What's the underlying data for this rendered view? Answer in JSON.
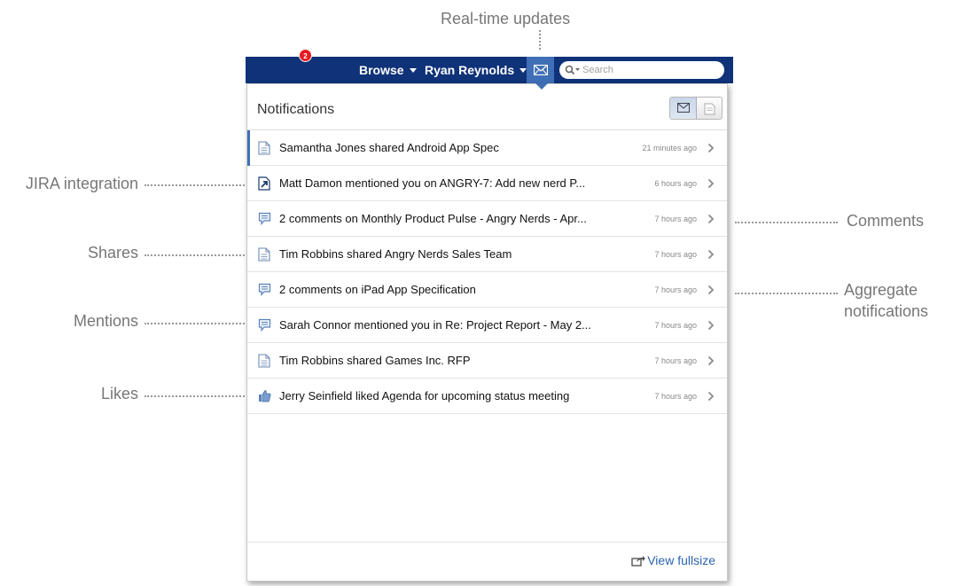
{
  "annotations": {
    "realtime": "Real-time updates",
    "jira": "JIRA integration",
    "shares": "Shares",
    "mentions": "Mentions",
    "likes": "Likes",
    "comments": "Comments",
    "aggregate_line1": "Aggregate",
    "aggregate_line2": "notifications"
  },
  "topbar": {
    "browse_label": "Browse",
    "user_label": "Ryan Reynolds",
    "badge_count": "2",
    "search_placeholder": "Search",
    "bar_color": "#0f3278",
    "mail_active_color": "#3f6fb6"
  },
  "panel": {
    "title": "Notifications",
    "view_fullsize": "View fullsize"
  },
  "notifications": [
    {
      "icon": "document-icon",
      "text": "Samantha Jones shared Android App Spec",
      "time": "21 minutes ago",
      "unread": true
    },
    {
      "icon": "jira-icon",
      "text": "Matt Damon mentioned you on ANGRY-7: Add new nerd P...",
      "time": "6 hours ago",
      "unread": false
    },
    {
      "icon": "comment-icon",
      "text": "2 comments on Monthly Product Pulse - Angry Nerds - Apr...",
      "time": "7 hours ago",
      "unread": false
    },
    {
      "icon": "document-icon",
      "text": "Tim Robbins shared Angry Nerds Sales Team",
      "time": "7 hours ago",
      "unread": false
    },
    {
      "icon": "comment-icon",
      "text": "2 comments on iPad App Specification",
      "time": "7 hours ago",
      "unread": false
    },
    {
      "icon": "comment-icon",
      "text": "Sarah Connor mentioned you in Re: Project Report - May 2...",
      "time": "7 hours ago",
      "unread": false
    },
    {
      "icon": "document-icon",
      "text": "Tim Robbins shared Games Inc. RFP",
      "time": "7 hours ago",
      "unread": false
    },
    {
      "icon": "thumbs-up-icon",
      "text": "Jerry Seinfield liked Agenda for upcoming status meeting",
      "time": "7 hours ago",
      "unread": false
    }
  ]
}
